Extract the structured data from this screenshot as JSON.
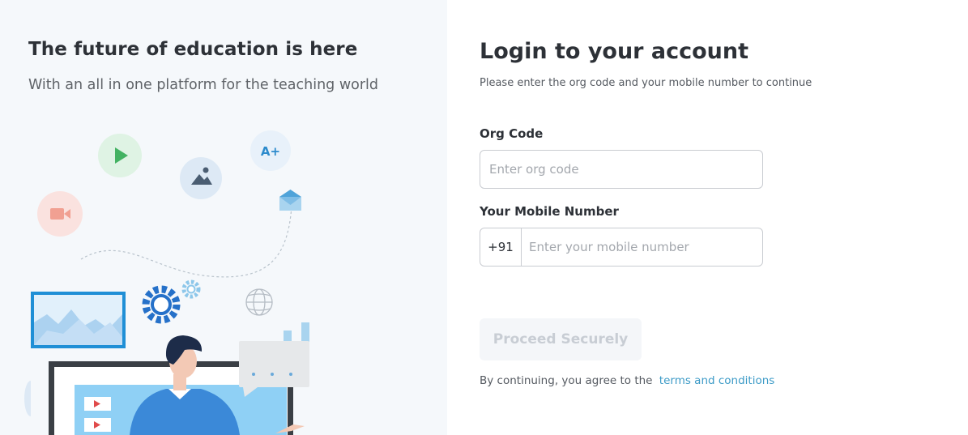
{
  "hero": {
    "title": "The future of education is here",
    "subtitle": "With an all in one platform for the teaching world"
  },
  "illustration": {
    "badge_text": "A+",
    "icons": [
      "play-icon",
      "image-icon",
      "grade-icon",
      "mail-icon",
      "video-camera-icon",
      "gear-icon",
      "globe-icon",
      "chart-icon"
    ]
  },
  "login": {
    "title": "Login to your account",
    "subtitle": "Please enter the org code and your mobile number to continue",
    "org_code": {
      "label": "Org Code",
      "value": "",
      "placeholder": "Enter org code"
    },
    "mobile": {
      "label": "Your Mobile Number",
      "country_code": "+91",
      "value": "",
      "placeholder": "Enter your mobile number"
    },
    "proceed_label": "Proceed Securely",
    "terms_prefix": "By continuing, you agree to the",
    "terms_link": "terms and conditions"
  },
  "colors": {
    "left_background": "#f5f8fb",
    "link": "#3d9bc7",
    "button_disabled_bg": "#f4f6f9",
    "button_disabled_text": "#c8cdd4"
  }
}
